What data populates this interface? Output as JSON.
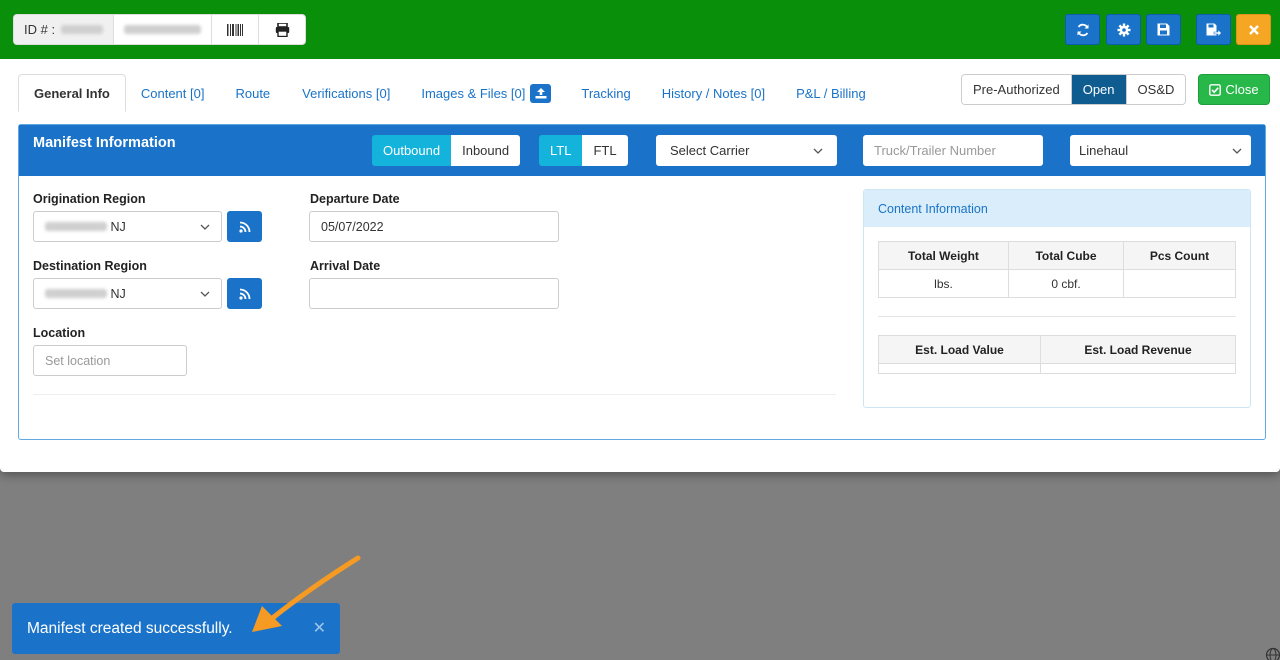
{
  "header": {
    "id_label": "ID # :",
    "buttons": [
      "refresh-icon",
      "gear-icon",
      "save-icon",
      "save-as-icon",
      "close-icon"
    ],
    "colors": {
      "topbar": "#0a8f0a",
      "primary": "#1a73c8",
      "warning": "#f5a623"
    }
  },
  "tabs": [
    {
      "label": "General Info"
    },
    {
      "label": "Content [0]"
    },
    {
      "label": "Route"
    },
    {
      "label": "Verifications [0]"
    },
    {
      "label": "Images & Files [0]"
    },
    {
      "label": "Tracking"
    },
    {
      "label": "History / Notes [0]"
    },
    {
      "label": "P&L / Billing"
    }
  ],
  "status": {
    "options": [
      "Pre-Authorized",
      "Open",
      "OS&D"
    ],
    "selected": "Open"
  },
  "close_label": "Close",
  "manifest": {
    "title": "Manifest Information",
    "direction": [
      "Outbound",
      "Inbound"
    ],
    "mode": [
      "LTL",
      "FTL"
    ],
    "carrier_placeholder": "Select Carrier",
    "truck_placeholder": "Truck/Trailer Number",
    "type_value": "Linehaul"
  },
  "form": {
    "origination_label": "Origination Region",
    "origination_value": "NJ",
    "destination_label": "Destination Region",
    "destination_value": "NJ",
    "location_label": "Location",
    "location_placeholder": "Set location",
    "departure_label": "Departure Date",
    "departure_value": "05/07/2022",
    "arrival_label": "Arrival Date",
    "arrival_value": ""
  },
  "content_info": {
    "title": "Content Information",
    "headers": [
      "Total Weight",
      "Total Cube",
      "Pcs Count"
    ],
    "values": [
      "lbs.",
      "0 cbf.",
      ""
    ],
    "value_headers": [
      "Est. Load Value",
      "Est. Load Revenue"
    ]
  },
  "toast": {
    "message": "Manifest created successfully."
  }
}
